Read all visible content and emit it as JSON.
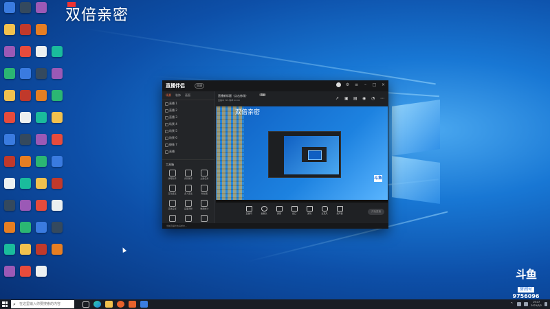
{
  "desktop": {
    "overlay_title": "双倍亲密",
    "icon_labels": []
  },
  "app": {
    "logo_text": "直播伴侣",
    "version_badge": "回流",
    "tabs": [
      "场景",
      "装饰",
      "画面"
    ],
    "scenes": [
      "直播 1",
      "直播 2",
      "直播 3",
      "场景 4",
      "场景 5",
      "场景 6",
      "摄像 7",
      "直播"
    ],
    "tools_heading": "工具箱",
    "tools": [
      {
        "label": "弹幕助手"
      },
      {
        "label": "房管助手"
      },
      {
        "label": "主播任务"
      },
      {
        "label": "互动连麦"
      },
      {
        "label": "多人连麦"
      },
      {
        "label": "粉丝团"
      },
      {
        "label": "直播设置"
      },
      {
        "label": "画面调整"
      },
      {
        "label": "数据统计"
      },
      {
        "label": ""
      },
      {
        "label": ""
      },
      {
        "label": ""
      }
    ],
    "stream_title": "直播新标题（点击修改）",
    "stream_badge": "直播",
    "stream_sub": "直播中  FPS  码率  00:00",
    "preview_title": "双倍亲密",
    "preview_brand": "斗鱼",
    "controls": [
      "直播间",
      "摄像头",
      "屏幕",
      "窗口",
      "游戏",
      "麦克风",
      "扬声器"
    ],
    "go_live_label": "开始直播",
    "status_text": "当前直播状态请求中..."
  },
  "room": {
    "logo": "斗鱼",
    "label": "房间号",
    "number": "9756096"
  },
  "taskbar": {
    "search_placeholder": "在这里输入你要搜索的内容",
    "time": "19:47",
    "date": "2021/3/2"
  },
  "colors": {
    "accent": "#ff6a3d",
    "douyu_blue": "#1a68d6"
  }
}
